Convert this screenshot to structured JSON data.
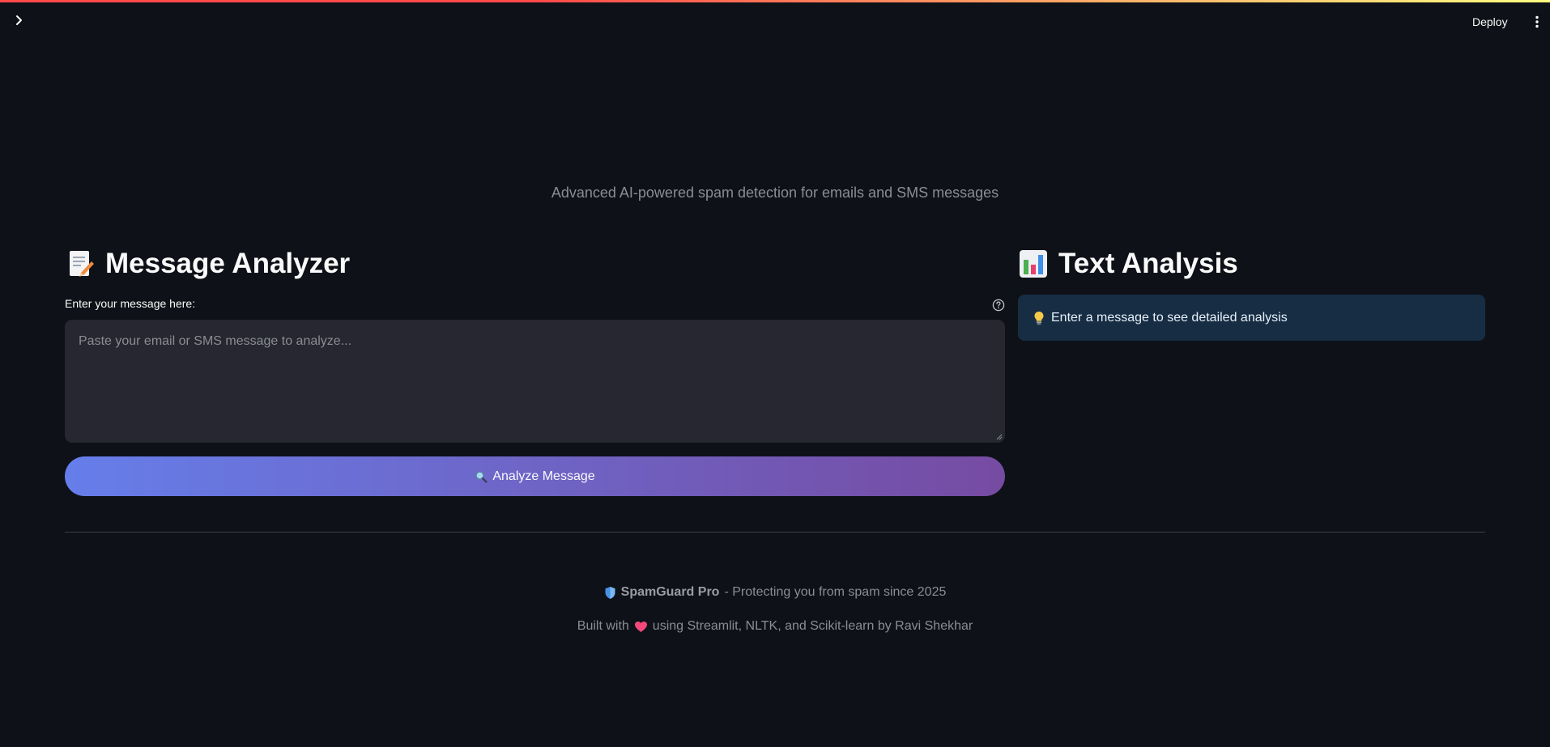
{
  "header": {
    "sidebar_toggle_icon": "chevron-right-icon",
    "deploy_label": "Deploy",
    "menu_icon": "vertical-dots-icon"
  },
  "subtitle": "Advanced AI-powered spam detection for emails and SMS messages",
  "analyzer": {
    "title_icon": "memo-icon",
    "title": "Message Analyzer",
    "input_label": "Enter your message here:",
    "help_icon": "question-circle-icon",
    "input_value": "",
    "input_placeholder": "Paste your email or SMS message to analyze...",
    "button_icon": "magnifier-icon",
    "button_label": "Analyze Message"
  },
  "text_analysis": {
    "title_icon": "bar-chart-icon",
    "title": "Text Analysis",
    "info_icon": "lightbulb-icon",
    "info_text": "Enter a message to see detailed analysis"
  },
  "footer": {
    "shield_icon": "shield-icon",
    "brand": "SpamGuard Pro",
    "tagline": "- Protecting you from spam since 2025",
    "built_prefix": "Built with",
    "heart_icon": "heart-icon",
    "built_suffix": "using Streamlit, NLTK, and Scikit-learn by Ravi Shekhar"
  },
  "colors": {
    "background": "#0e1117",
    "input_bg": "#262730",
    "info_bg": "#172d43",
    "button_gradient_start": "#667eea",
    "button_gradient_end": "#764ba2",
    "muted_text": "#8b8d93",
    "top_line_start": "#ff4b4b",
    "top_line_end": "#fffd80"
  }
}
